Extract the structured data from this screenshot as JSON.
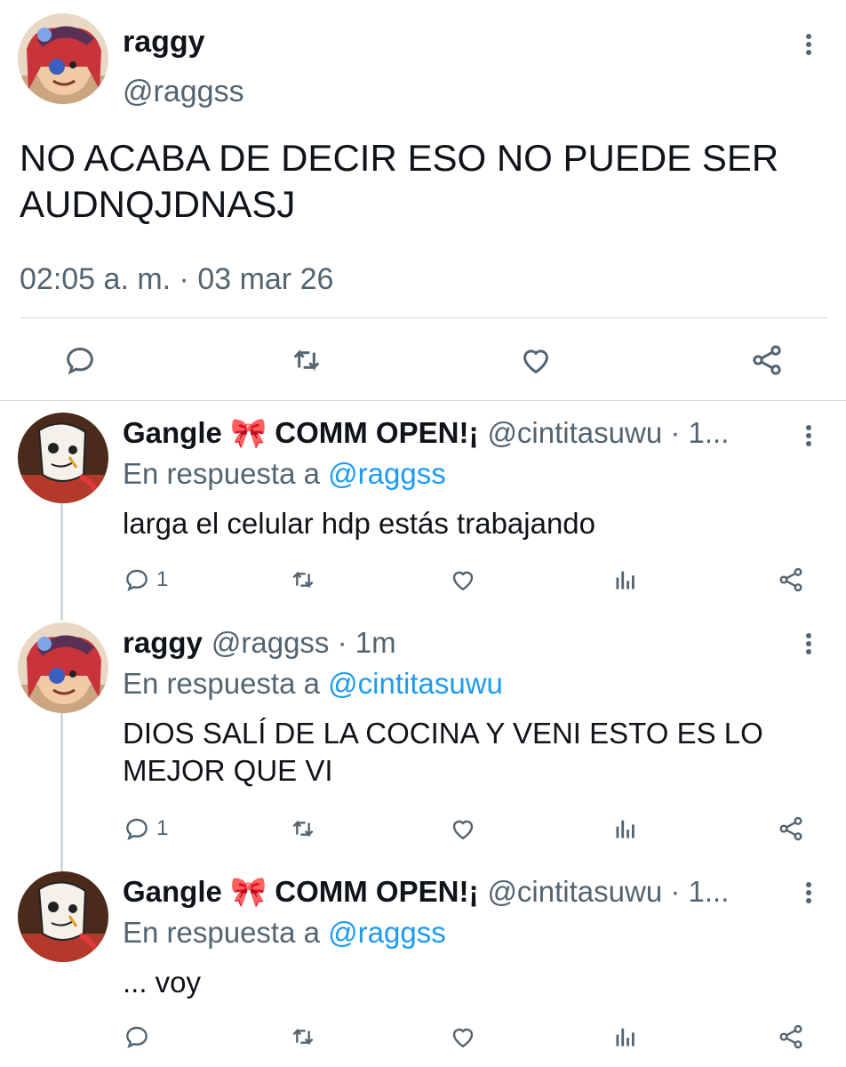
{
  "main_tweet": {
    "name": "raggy",
    "handle": "@raggss",
    "text_line1": "NO ACABA DE DECIR ESO NO PUEDE SER",
    "text_line2": "AUDNQJDNASJ",
    "timestamp": "02:05 a. m. · 03 mar 26",
    "actions": [
      "reply-icon",
      "retweet-icon",
      "like-icon",
      "share-icon"
    ]
  },
  "replies": [
    {
      "name": "Gangle 🎀 COMM OPEN!¡",
      "handle_time": "@cintitasuwu · 1...",
      "reply_prefix": "En respuesta a",
      "reply_to": "@raggss",
      "text_line1": "larga el celular hdp estás trabajando",
      "reply_count": "1"
    },
    {
      "name": "raggy",
      "handle_time": "@raggss · 1m",
      "reply_prefix": "En respuesta a",
      "reply_to": "@cintitasuwu",
      "text_line1": "DIOS SALÍ DE LA COCINA Y VENI ESTO ES LO",
      "text_line2": "MEJOR QUE VI",
      "reply_count": "1"
    },
    {
      "name": "Gangle 🎀 COMM OPEN!¡",
      "handle_time": "@cintitasuwu · 1...",
      "reply_prefix": "En respuesta a",
      "reply_to": "@raggss",
      "text_line1": "... voy",
      "reply_count": ""
    }
  ],
  "colors": {
    "accent": "#1d9bf0",
    "muted": "#536471",
    "text": "#0f1419",
    "divider": "#cfd9de"
  }
}
